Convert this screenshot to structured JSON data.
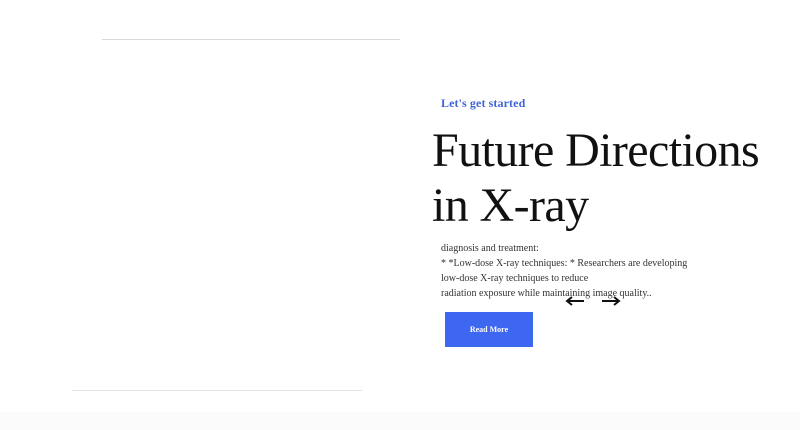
{
  "hero": {
    "kicker": "Let's get started",
    "title_line1": "Future Directions",
    "title_line2": "in X-ray",
    "body_lines": [
      "diagnosis and treatment:",
      "* *Low-dose X-ray techniques: * Researchers are developing",
      "low-dose X-ray techniques to reduce",
      "radiation exposure while maintaining image quality.."
    ],
    "cta_label": "Read More"
  },
  "carousel": {
    "prev_icon": "arrow-left-icon",
    "next_icon": "arrow-right-icon"
  },
  "colors": {
    "accent": "#3d66f1",
    "kicker": "#3e64d6"
  }
}
